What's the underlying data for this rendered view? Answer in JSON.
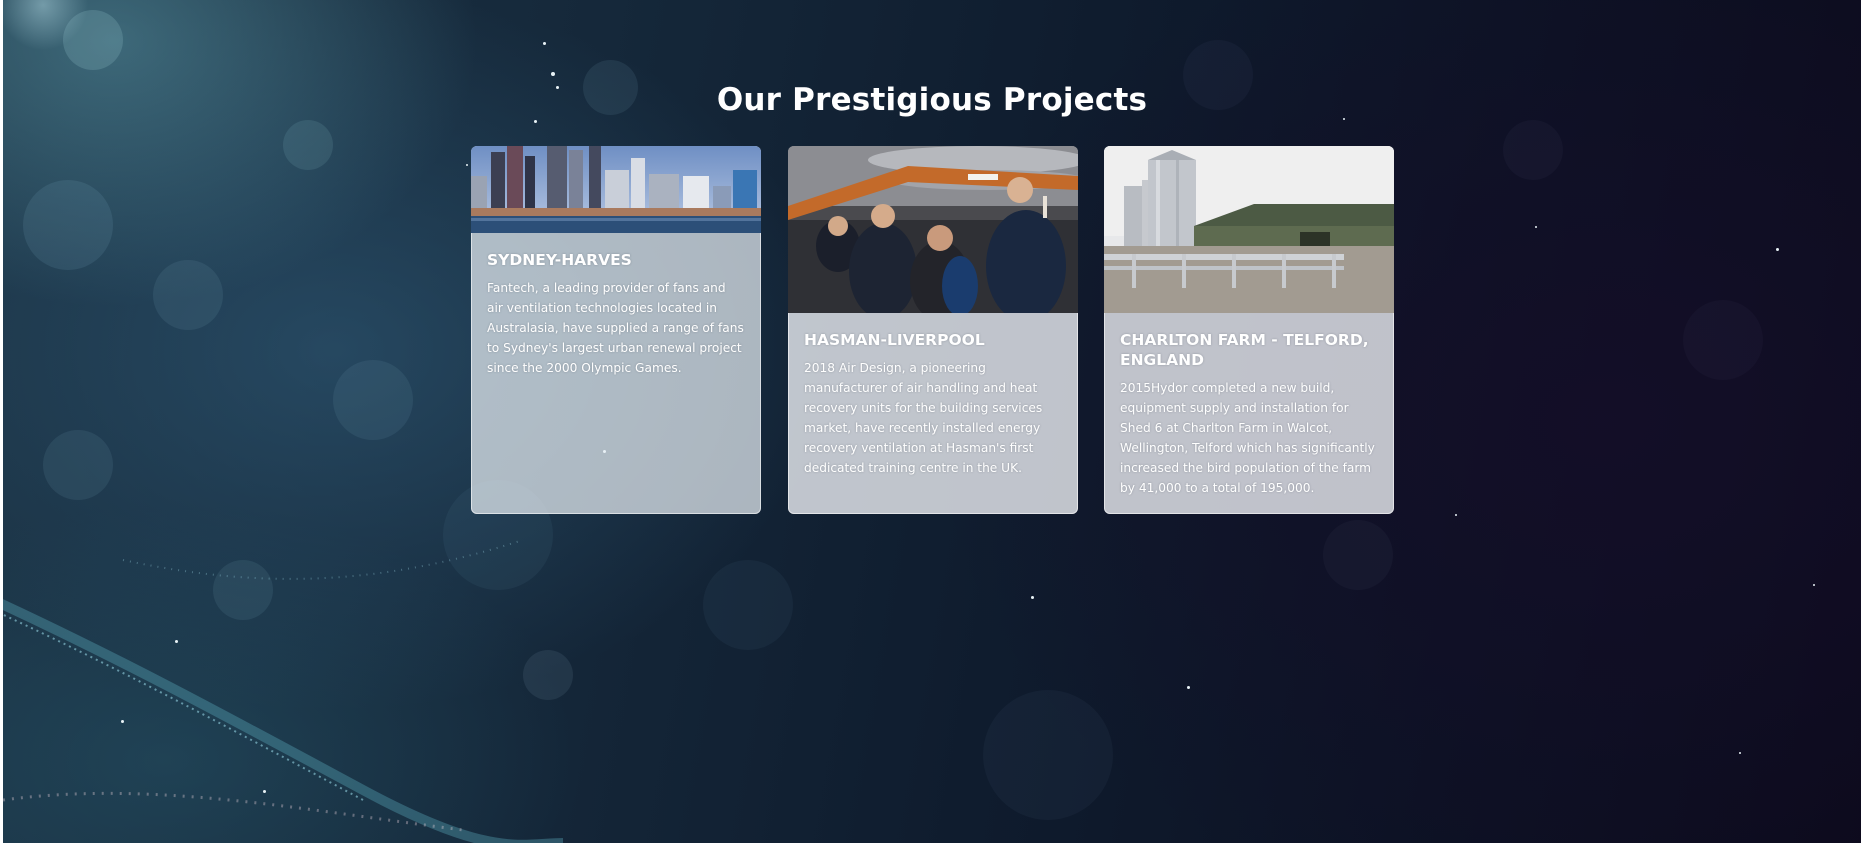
{
  "section": {
    "title": "Our Prestigious Projects"
  },
  "projects": [
    {
      "title": "SYDNEY-HARVES",
      "description": "Fantech, a leading provider of fans and air ventilation technologies located in Australasia, have supplied a range of fans to Sydney's largest urban renewal project since the 2000 Olympic Games.",
      "image": "sydney-waterfront-skyline-photo"
    },
    {
      "title": "HASMAN-LIVERPOOL",
      "description": "2018 Air Design, a pioneering manufacturer of air handling and heat recovery units for the building services market, have recently installed energy recovery ventilation at Hasman's first dedicated training centre in the UK.",
      "image": "training-centre-group-under-ducts-photo"
    },
    {
      "title": "CHARLTON FARM - TELFORD, ENGLAND",
      "description": "2015Hydor completed a new build, equipment supply and installation for Shed 6 at Charlton Farm in Walcot, Wellington, Telford which has significantly increased the bird population of the farm by 41,000 to a total of 195,000.",
      "image": "farm-shed-and-silos-photo"
    }
  ],
  "colors": {
    "background_dark": "#0c1224",
    "background_teal": "#1c3446",
    "heading": "#ffffff",
    "card_overlay": "#eceff4"
  }
}
